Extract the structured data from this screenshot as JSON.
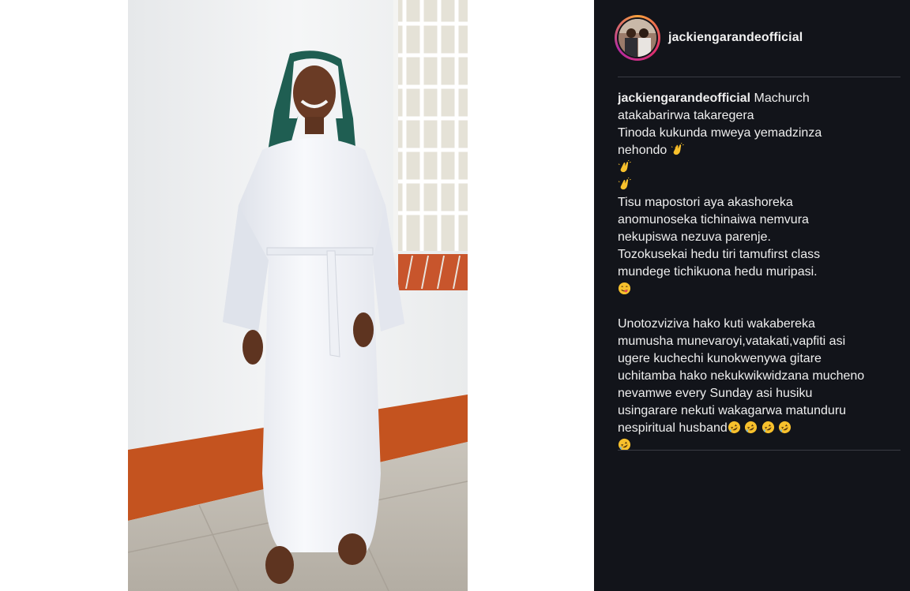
{
  "post": {
    "username": "jackiengarandeofficial",
    "caption": {
      "author": "jackiengarandeofficial",
      "lines": [
        "Machurch",
        "atakabarirwa takaregera",
        "Tinoda kukunda mweya yemadzinza",
        "nehondo",
        "Tisu mapostori aya akashoreka",
        "anomunoseka tichinaiwa nemvura",
        "nekupiswa nezuva parenje.",
        "Tozokusekai hedu tiri tamufirst class",
        "mundege tichikuona hedu muripasi.",
        "Unotozviziva hako kuti wakabereka",
        "mumusha munevaroyi,vatakati,vapfiti asi",
        "ugere kuchechi kunokwenywa gitare",
        "uchitamba hako nekukwikwidzana mucheno",
        "nevamwe every Sunday asi husiku",
        "usingarare nekuti wakagarwa matunduru",
        "nespiritual husband"
      ]
    },
    "emojis": {
      "clap": "clapping-hands-emoji",
      "yum": "face-savoring-food-emoji",
      "rofl": "rolling-on-floor-laughing-emoji"
    }
  },
  "colors": {
    "panel_bg": "#12141a",
    "text": "#eeeeee",
    "divider": "#3a3c44",
    "emoji_yellow": "#f7c02c"
  }
}
